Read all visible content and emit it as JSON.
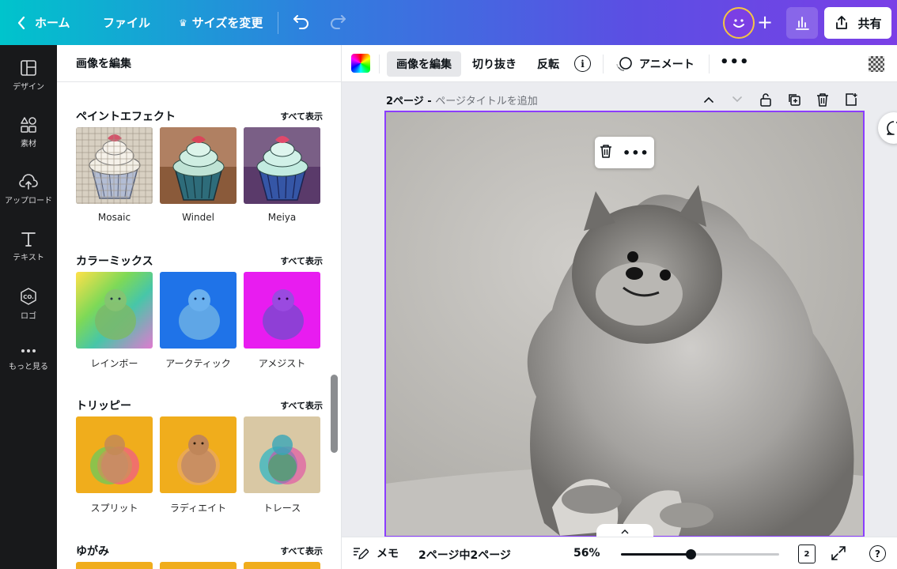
{
  "topbar": {
    "home_label": "ホーム",
    "file_label": "ファイル",
    "resize_label": "サイズを変更",
    "share_label": "共有",
    "accent_gradient": [
      "#00c4cc",
      "#5b4fe3",
      "#7a3fe6"
    ]
  },
  "leftnav": {
    "items": [
      {
        "label": "デザイン",
        "icon": "layout-icon"
      },
      {
        "label": "素材",
        "icon": "shapes-icon"
      },
      {
        "label": "アップロード",
        "icon": "cloud-upload-icon"
      },
      {
        "label": "テキスト",
        "icon": "text-icon"
      },
      {
        "label": "ロゴ",
        "icon": "logo-icon"
      },
      {
        "label": "もっと見る",
        "icon": "more-icon"
      }
    ]
  },
  "panel": {
    "title": "画像を編集",
    "sections": [
      {
        "title": "ペイントエフェクト",
        "see_all": "すべて表示",
        "items": [
          {
            "label": "Mosaic"
          },
          {
            "label": "Windel"
          },
          {
            "label": "Meiya"
          }
        ]
      },
      {
        "title": "カラーミックス",
        "see_all": "すべて表示",
        "items": [
          {
            "label": "レインボー"
          },
          {
            "label": "アークティック"
          },
          {
            "label": "アメジスト"
          }
        ]
      },
      {
        "title": "トリッピー",
        "see_all": "すべて表示",
        "items": [
          {
            "label": "スプリット"
          },
          {
            "label": "ラディエイト"
          },
          {
            "label": "トレース"
          }
        ]
      },
      {
        "title": "ゆがみ",
        "see_all": "すべて表示",
        "items": []
      }
    ]
  },
  "toolbar": {
    "edit_image": "画像を編集",
    "crop": "切り抜き",
    "flip": "反転",
    "info": "i",
    "animate": "アニメート"
  },
  "page": {
    "number_label": "2ページ - ",
    "title_placeholder": "ページタイトルを追加"
  },
  "bottombar": {
    "notes_label": "メモ",
    "page_count": "2ページ中2ページ",
    "zoom": "56%",
    "zoom_fraction": 0.44,
    "pages_badge": "2",
    "help": "?"
  },
  "colors": {
    "selection": "#8b3dff",
    "nav_bg": "#18191b"
  }
}
